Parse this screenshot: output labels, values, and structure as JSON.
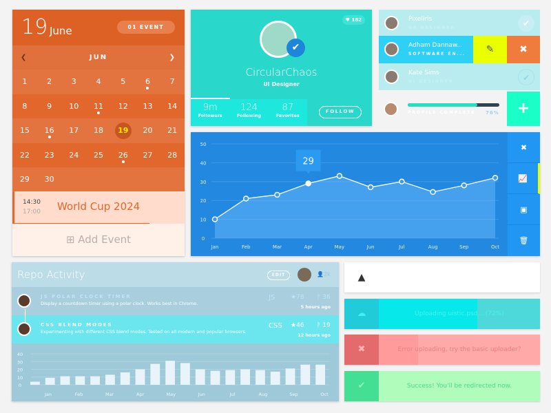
{
  "calendar": {
    "day": "19",
    "month_name": "June",
    "event_badge": "01 EVENT",
    "nav_month": "JUN",
    "prev_icon": "chevron-left",
    "next_icon": "chevron-right",
    "weeks": [
      [
        "1",
        "2",
        "3",
        "4",
        "5",
        "6",
        "7"
      ],
      [
        "8",
        "9",
        "10",
        "11",
        "12",
        "13",
        "14"
      ],
      [
        "15",
        "16",
        "17",
        "18",
        "19",
        "20",
        "21"
      ],
      [
        "22",
        "23",
        "24",
        "25",
        "26",
        "27",
        "28"
      ],
      [
        "29",
        "30",
        "",
        "",
        "",
        "",
        ""
      ]
    ],
    "event_days": [
      "6",
      "11",
      "16",
      "26"
    ],
    "today": "19",
    "event": {
      "start": "14:30",
      "end": "17:00",
      "title": "World Cup 2024"
    },
    "add_label": "Add Event"
  },
  "profile": {
    "likes": "182",
    "name": "CircularChaos",
    "role": "UI Designer",
    "stats": [
      {
        "value": "9m",
        "label": "Followers"
      },
      {
        "value": "124",
        "label": "Following"
      },
      {
        "value": "87",
        "label": "Favorites"
      }
    ],
    "follow_label": "FOLLOW"
  },
  "users": {
    "items": [
      {
        "name": "Pixeliris",
        "role": "UX DESIGNER"
      },
      {
        "name": "Adham Dannaw...",
        "role": "SOFTWARE EN..."
      },
      {
        "name": "Kate Sims",
        "role": "UI DESIGNER"
      }
    ],
    "profile_progress": {
      "label": "PROFILE COMPLETE",
      "percent": 76,
      "text": "76%"
    }
  },
  "line_chart": {
    "tooltip": "29",
    "sidebar_icons": [
      "close-icon",
      "chart-icon",
      "money-icon",
      "trash-icon"
    ]
  },
  "repo": {
    "title": "Repo Activity",
    "edit_label": "EDIT",
    "followers": "2k",
    "items": [
      {
        "title": "JS POLAR CLOCK TIMER",
        "desc": "Display a countdown timer using a polar clock. Works best in Chrome.",
        "lang": "JS",
        "stars": "78",
        "forks": "36",
        "time": "5 hours ago"
      },
      {
        "title": "CSS BLEND MODES",
        "desc": "Experimenting with different CSS blend modes. Tested on all modern and popular browsers.",
        "lang": "CSS",
        "stars": "46",
        "forks": "19",
        "time": "12 hours ago"
      }
    ]
  },
  "alerts": [
    {
      "type": "warning",
      "icon": "warning-icon",
      "text": ""
    },
    {
      "type": "upload",
      "icon": "cloud-upload-icon",
      "text": "Uploading uistic.psd....(72%)",
      "progress": 72
    },
    {
      "type": "error",
      "icon": "close-icon",
      "text": "Error uploading, try the basic uploader?"
    },
    {
      "type": "success",
      "icon": "check-icon",
      "text": "Success! You'll be redirected now."
    }
  ],
  "chart_data": [
    {
      "type": "line",
      "categories": [
        "Jan",
        "Feb",
        "Mar",
        "Apr",
        "May",
        "Jun",
        "Jul",
        "Aug",
        "Sep",
        "Oct"
      ],
      "values": [
        10,
        21,
        23,
        29,
        33,
        27,
        30,
        24.5,
        28,
        32
      ],
      "ylim": [
        0,
        50
      ],
      "yticks": [
        0,
        10,
        20,
        30,
        40,
        50
      ],
      "grid": true,
      "highlight": "Apr"
    },
    {
      "type": "bar",
      "categories": [
        "Jan",
        "Feb",
        "Mar",
        "Apr",
        "May",
        "Jun",
        "Jul",
        "Aug",
        "Sep",
        "Oct"
      ],
      "values": [
        4,
        9,
        11,
        11,
        11,
        13,
        16,
        20,
        27,
        31,
        28,
        20,
        18,
        19,
        20,
        19,
        17,
        21,
        26,
        26
      ],
      "ylim": [
        0,
        40
      ],
      "yticks": [
        0,
        10,
        20,
        30,
        40
      ],
      "grid": true
    }
  ]
}
